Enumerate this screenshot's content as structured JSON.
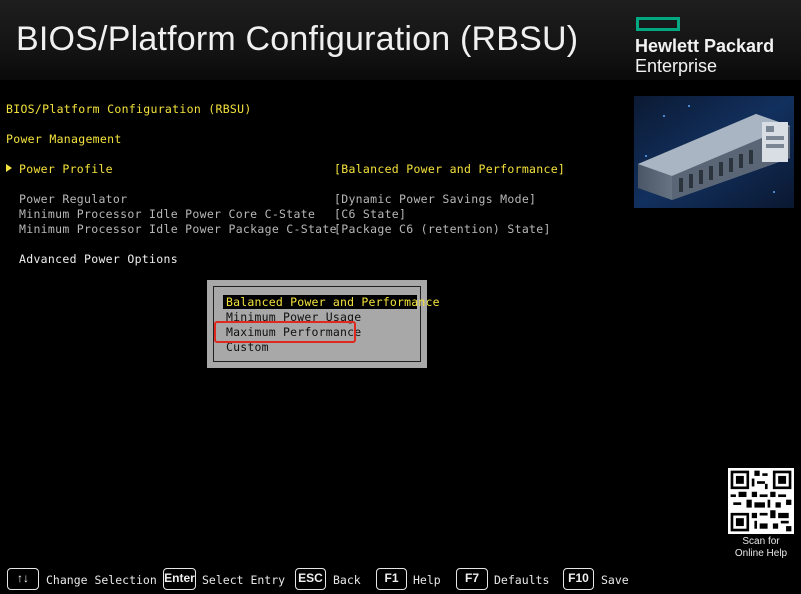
{
  "header": {
    "title": "BIOS/Platform Configuration (RBSU)",
    "brand_line1": "Hewlett Packard",
    "brand_line2": "Enterprise",
    "brand_color": "#01a982"
  },
  "breadcrumb": {
    "path": "BIOS/Platform Configuration (RBSU)",
    "section": "Power Management"
  },
  "settings": [
    {
      "label": "Power Profile",
      "value": "[Balanced Power and Performance]"
    },
    {
      "label": "Power Regulator",
      "value": "[Dynamic Power Savings Mode]"
    },
    {
      "label": "Minimum Processor Idle Power Core C-State",
      "value": "[C6 State]"
    },
    {
      "label": "Minimum Processor Idle Power Package C-State",
      "value": "[Package C6 (retention) State]"
    },
    {
      "label": "Advanced Power Options"
    }
  ],
  "popup": {
    "options": [
      "Balanced Power and Performance",
      "Minimum Power Usage",
      "Maximum Performance",
      "Custom"
    ],
    "selected": "Balanced Power and Performance",
    "highlighted": "Maximum Performance",
    "highlight_color": "#e0291e"
  },
  "qr": {
    "caption_line1": "Scan for",
    "caption_line2": "Online Help"
  },
  "footer": {
    "keys": [
      {
        "key": "↑↓",
        "label": "Change Selection"
      },
      {
        "key": "Enter",
        "label": "Select Entry"
      },
      {
        "key": "ESC",
        "label": "Back"
      },
      {
        "key": "F1",
        "label": "Help"
      },
      {
        "key": "F7",
        "label": "Defaults"
      },
      {
        "key": "F10",
        "label": "Save"
      }
    ]
  },
  "colors": {
    "text_yellow": "#f3e23c",
    "text_gray": "#b8b8b8",
    "background": "#000000"
  }
}
